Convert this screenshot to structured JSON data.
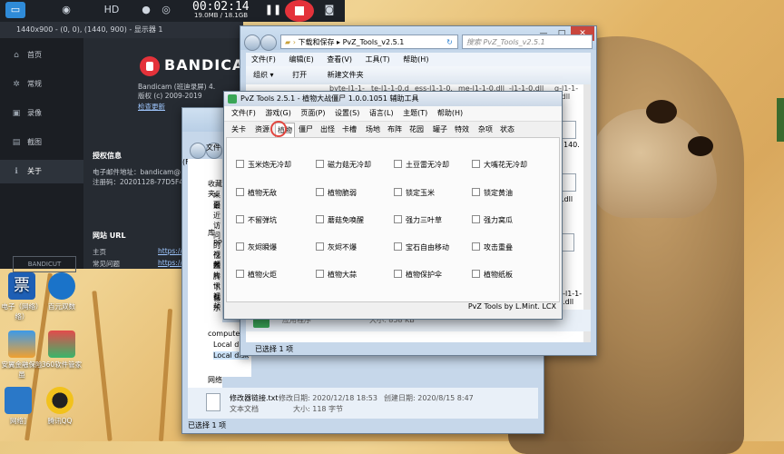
{
  "bandicam_bar": {
    "timer": "00:02:14",
    "size": "19.0MB / 18.1GB",
    "icons": [
      "monitor-icon",
      "gamepad-icon",
      "hdmi-icon",
      "mic-icon",
      "webcam-icon",
      "pause-icon",
      "stop-icon",
      "camera-icon"
    ]
  },
  "bandicam": {
    "header": "1440x900 - (0, 0), (1440, 900) - 显示器 1",
    "sidebar": [
      {
        "icon": "home-icon",
        "label": "首页"
      },
      {
        "icon": "gear-icon",
        "label": "常规"
      },
      {
        "icon": "record-icon",
        "label": "录像"
      },
      {
        "icon": "image-icon",
        "label": "截图"
      },
      {
        "icon": "info-icon",
        "label": "关于"
      }
    ],
    "brand": "BANDICAM",
    "version_line": "Bandicam (班迪录屏) 4.",
    "copyright_line": "版权 (c) 2009-2019",
    "check_update": "检查更新",
    "license_heading": "授权信息",
    "email_line": "电子邮件地址：bandicam@",
    "serial_line": "注册码：20201128-77D5F4",
    "site_heading": "网站 URL",
    "home_label": "主页",
    "home_url": "https://",
    "faq_label": "常见问题",
    "faq_url": "https://",
    "bandicut": "BANDICUT"
  },
  "desktop_icons": [
    {
      "name": "电子（网络）",
      "line2": "络）"
    },
    {
      "name": "百元双数"
    },
    {
      "name": "安翼金融保险",
      "line2": "虽"
    },
    {
      "name": "360软件管家"
    },
    {
      "name": "网络]"
    },
    {
      "name": "腾讯QQ"
    }
  ],
  "explorer_back": {
    "menu": [
      "文件(F)"
    ],
    "nav": [
      "收藏夹",
      "桌面",
      "最近访问的位置",
      "库",
      "PP",
      "视频",
      "图片",
      "腾讯视频",
      "下载",
      "音乐",
      "computer",
      "Local disk",
      "Local disk",
      "网络"
    ],
    "selected_file": "修改器链接.txt",
    "file_type": "文本文档",
    "modified_label": "修改日期: 2020/12/18 18:53",
    "created_label": "创建日期: 2020/8/15 8:47",
    "size_label": "大小: 118 字节",
    "status": "已选择 1 项",
    "status_bottom": "已选择 1 项"
  },
  "explorer_front": {
    "breadcrumb_1": "下载和保存",
    "breadcrumb_2": "PvZ_Tools_v2.5.1",
    "search_placeholder": "搜索 PvZ_Tools_v2.5.1",
    "menu": [
      "文件(F)",
      "编辑(E)",
      "查看(V)",
      "工具(T)",
      "帮助(H)"
    ],
    "toolbar": [
      "组织 ▾",
      "打开",
      "新建文件夹"
    ],
    "files_row": [
      "byte-l1-1-",
      "te-l1-1-0.d",
      "ess-l1-1-0.",
      "me-l1-1-0.dll",
      "-l1-1-0.dll",
      "g-l1-1-0.dll"
    ],
    "right_files": [
      "140.",
      ".dll",
      "g-l1-1-0.dll"
    ],
    "app_type": "应用程序",
    "app_size": "大小: 858 KB",
    "status": "已选择 1 项"
  },
  "pvz": {
    "title": "PvZ Tools 2.5.1  -  植物大战僵尸 1.0.0.1051 辅助工具",
    "menu": [
      "文件(F)",
      "游戏(G)",
      "页面(P)",
      "设置(S)",
      "语言(L)",
      "主题(T)",
      "帮助(H)"
    ],
    "tabs": [
      "关卡",
      "资源",
      "植物",
      "僵尸",
      "出怪",
      "卡槽",
      "场地",
      "布阵",
      "花园",
      "罐子",
      "特效",
      "杂项",
      "状态"
    ],
    "selected_tab": "植物",
    "options": [
      [
        "玉米炮无冷却",
        "磁力菇无冷却",
        "土豆雷无冷却",
        "大嘴花无冷却"
      ],
      [
        "植物无敌",
        "植物脆弱",
        "锁定玉米",
        "锁定黄油"
      ],
      [
        "不留弹坑",
        "蘑菇免唤醒",
        "强力三叶草",
        "强力窝瓜"
      ],
      [
        "灰烬瞬爆",
        "灰烬不爆",
        "宝石自由移动",
        "攻击重叠"
      ],
      [
        "植物火炬",
        "植物大蒜",
        "植物保护伞",
        "植物纸板"
      ]
    ],
    "credit": "PvZ Tools by L.Mint. LCX"
  },
  "window_controls": [
    "—",
    "□",
    "✕"
  ]
}
